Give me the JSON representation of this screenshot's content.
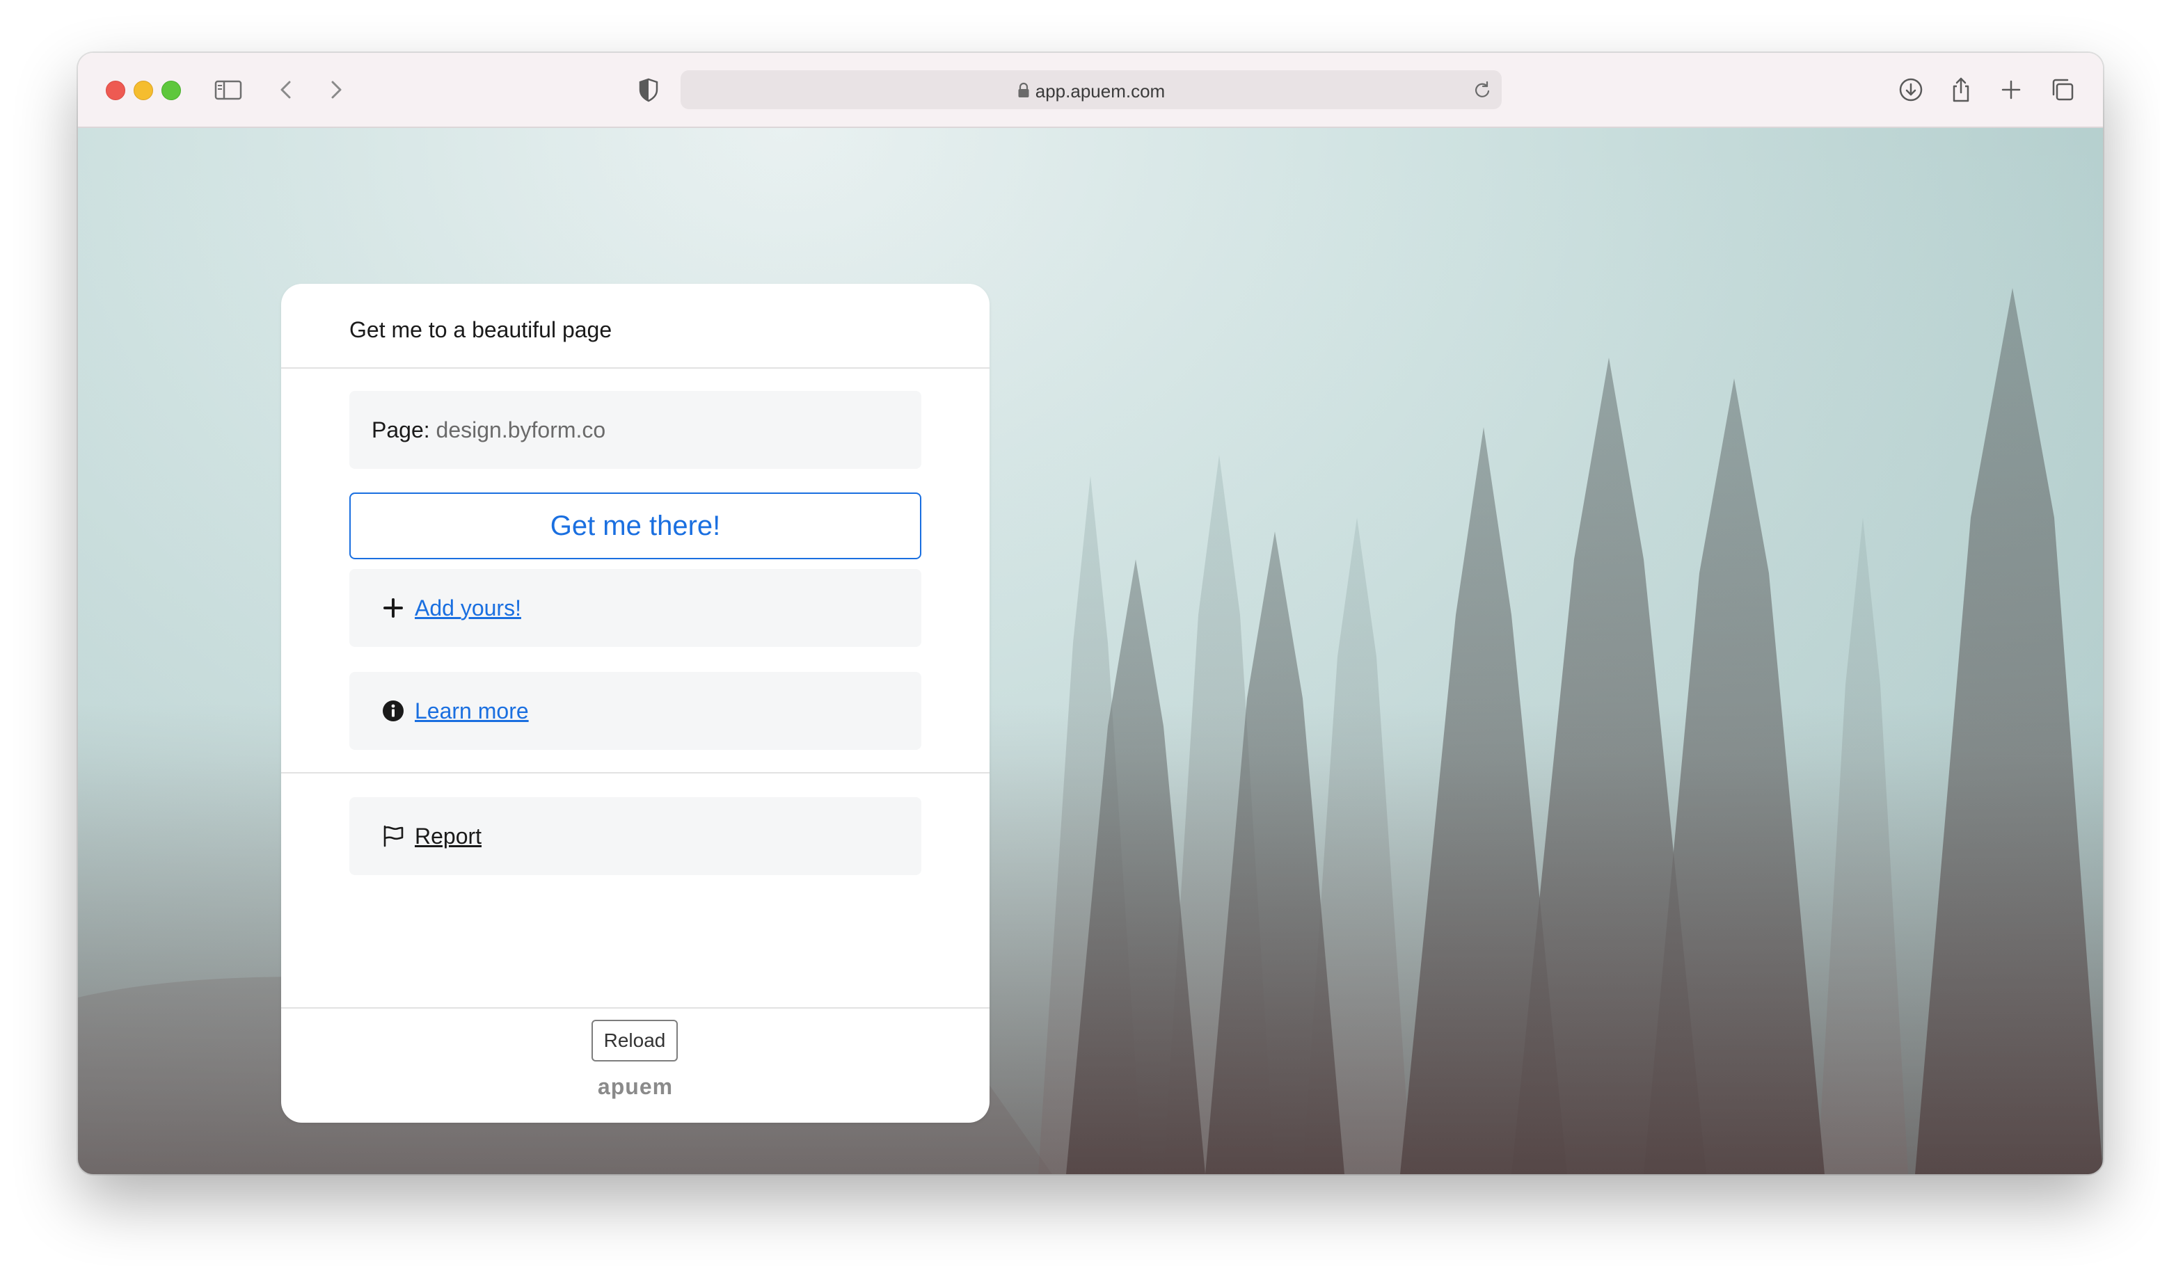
{
  "browser": {
    "url": "app.apuem.com",
    "icons": [
      "sidebar-icon",
      "back-icon",
      "forward-icon",
      "shield-icon",
      "lock-icon",
      "reload-icon",
      "download-icon",
      "share-icon",
      "new-tab-icon",
      "tabs-overview-icon"
    ]
  },
  "card": {
    "title": "Get me to a beautiful page",
    "page_field": {
      "label": "Page:",
      "value": "design.byform.co"
    },
    "go_button": "Get me there!",
    "add_link": "Add yours!",
    "learn_link": "Learn more",
    "report_link": "Report",
    "reload_button": "Reload",
    "brand": "apuem"
  },
  "colors": {
    "accent": "#1a6fe0",
    "card_background": "#ffffff",
    "field_background": "#f5f6f7"
  }
}
